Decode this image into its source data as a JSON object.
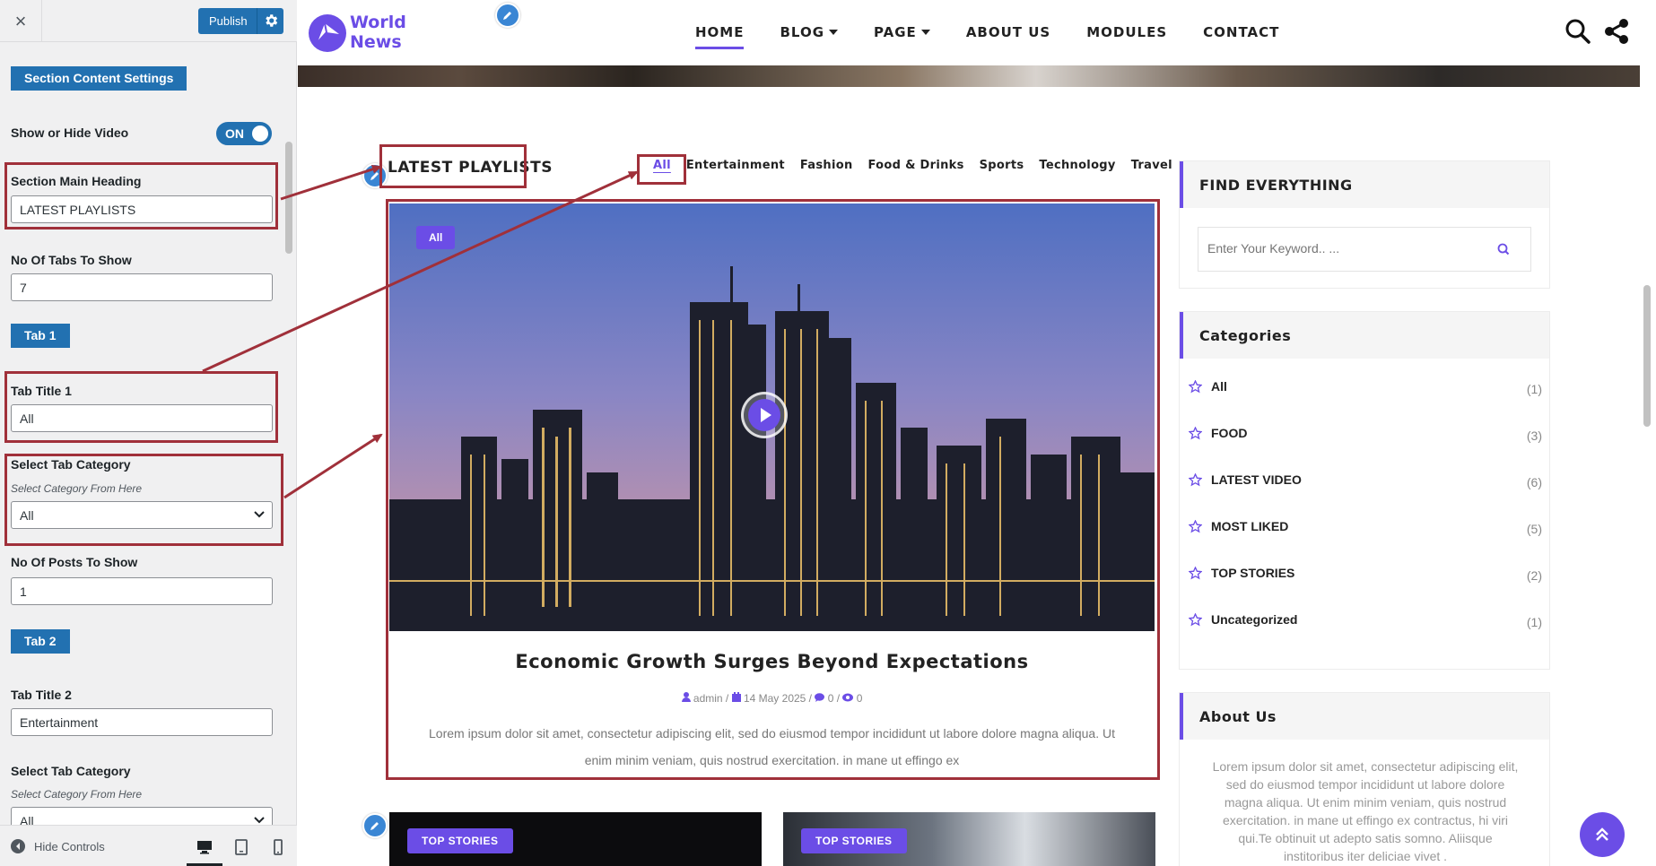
{
  "panel": {
    "close_label": "×",
    "publish_label": "Publish",
    "section_button": "Section Content Settings",
    "show_hide_video": {
      "label": "Show or Hide Video",
      "state": "ON"
    },
    "main_heading": {
      "label": "Section Main Heading",
      "value": "LATEST PLAYLISTS"
    },
    "tabs_to_show": {
      "label": "No Of Tabs To Show",
      "value": "7"
    },
    "tab1": {
      "button": "Tab 1",
      "title_label": "Tab Title 1",
      "title_value": "All",
      "category_label": "Select Tab Category",
      "category_desc": "Select Category From Here",
      "category_value": "All",
      "posts_label": "No Of Posts To Show",
      "posts_value": "1"
    },
    "tab2": {
      "button": "Tab 2",
      "title_label": "Tab Title 2",
      "title_value": "Entertainment",
      "category_label": "Select Tab Category",
      "category_desc": "Select Category From Here",
      "category_value": "All"
    },
    "footer": {
      "hide_controls": "Hide Controls"
    }
  },
  "site": {
    "logo": {
      "line1": "World",
      "line2": "News"
    },
    "nav": [
      {
        "label": "HOME",
        "active": true
      },
      {
        "label": "BLOG",
        "dropdown": true
      },
      {
        "label": "PAGE",
        "dropdown": true
      },
      {
        "label": "ABOUT US"
      },
      {
        "label": "MODULES"
      },
      {
        "label": "CONTACT"
      }
    ],
    "section_title": "LATEST PLAYLISTS",
    "tabs": [
      "All",
      "Entertainment",
      "Fashion",
      "Food & Drinks",
      "Sports",
      "Technology",
      "Travel"
    ],
    "featured": {
      "badge": "All",
      "title": "Economic Growth Surges Beyond Expectations",
      "author": "admin",
      "date": "14 May 2025",
      "comments": "0",
      "views": "0",
      "excerpt": "Lorem ipsum dolor sit amet, consectetur adipiscing elit, sed do eiusmod tempor incididunt ut labore dolore magna aliqua. Ut enim minim veniam, quis nostrud exercitation. in mane ut effingo ex"
    },
    "thumbs": [
      {
        "badge": "TOP STORIES"
      },
      {
        "badge": "TOP STORIES"
      }
    ],
    "sidebar": {
      "find": {
        "title": "FIND EVERYTHING",
        "placeholder": "Enter Your Keyword.. ..."
      },
      "categories": {
        "title": "Categories",
        "items": [
          {
            "name": "All",
            "count": "(1)"
          },
          {
            "name": "FOOD",
            "count": "(3)"
          },
          {
            "name": "LATEST VIDEO",
            "count": "(6)"
          },
          {
            "name": "MOST LIKED",
            "count": "(5)"
          },
          {
            "name": "TOP STORIES",
            "count": "(2)"
          },
          {
            "name": "Uncategorized",
            "count": "(1)"
          }
        ]
      },
      "about": {
        "title": "About Us",
        "text": "Lorem ipsum dolor sit amet, consectetur adipiscing elit, sed do eiusmod tempor incididunt ut labore dolore magna aliqua. Ut enim minim veniam, quis nostrud exercitation. in mane ut effingo ex contractus, hi viri qui.Te obtinuit ut adepto satis somno. Aliisque institoribus iter deliciae vivet ."
      }
    }
  },
  "colors": {
    "accent": "#6b4de6",
    "wp_blue": "#2271b1",
    "highlight": "#a0303a"
  }
}
